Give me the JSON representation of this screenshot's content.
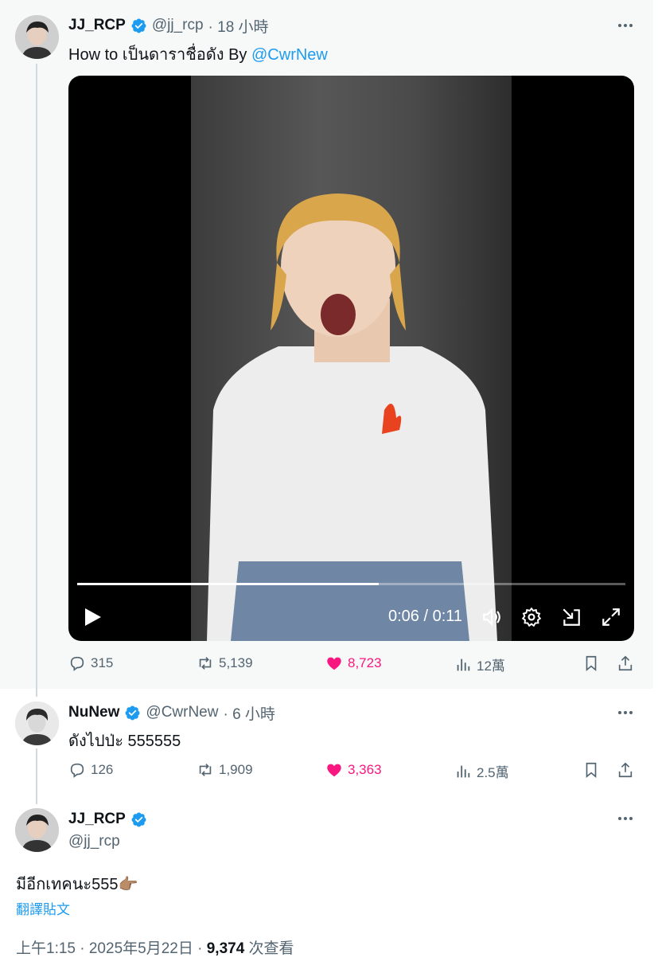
{
  "thread": [
    {
      "author": {
        "name": "JJ_RCP",
        "handle": "@jj_rcp",
        "time": "· 18 小時"
      },
      "text_prefix": "How to เป็นดาราชื่อดัง By ",
      "text_mention": "@CwrNew",
      "video": {
        "time_display": "0:06 / 0:11",
        "progress": 0.55
      },
      "stats": {
        "replies": "315",
        "retweets": "5,139",
        "likes": "8,723",
        "views": "12萬"
      }
    },
    {
      "author": {
        "name": "NuNew",
        "handle": "@CwrNew",
        "time": "· 6 小時"
      },
      "text": "ดังไปป่ะ 555555",
      "stats": {
        "replies": "126",
        "retweets": "1,909",
        "likes": "3,363",
        "views": "2.5萬"
      }
    },
    {
      "author": {
        "name": "JJ_RCP",
        "handle": "@jj_rcp"
      },
      "text": "มีอีกเทคนะ555",
      "emoji": "👉🏽",
      "translate_label": "翻譯貼文",
      "timestamp": "上午1:15 · 2025年5月22日 · ",
      "views_count": "9,374",
      "views_label": " 次查看"
    }
  ],
  "icons": {
    "reply": "reply-icon",
    "retweet": "retweet-icon",
    "like": "heart-icon",
    "views": "analytics-icon",
    "bookmark": "bookmark-icon",
    "share": "share-icon",
    "verified": "verified-badge-icon",
    "more": "more-icon"
  },
  "colors": {
    "accent": "#1d9bf0",
    "like": "#f91880",
    "muted": "#536471"
  }
}
